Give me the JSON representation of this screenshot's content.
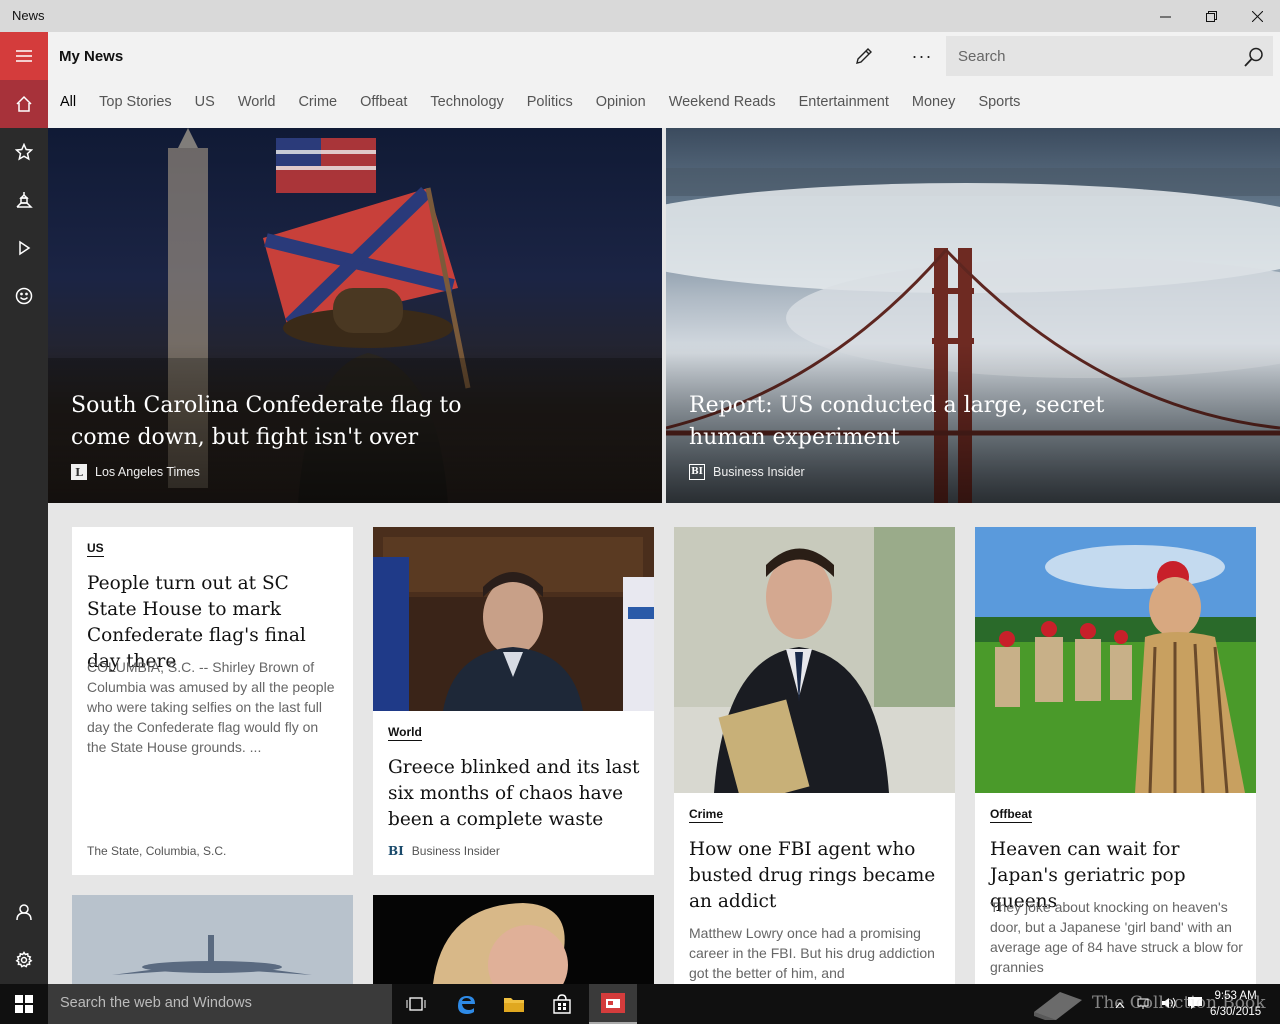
{
  "window": {
    "title": "News"
  },
  "header": {
    "page_title": "My News",
    "search_placeholder": "Search",
    "more_label": "···"
  },
  "tabs": [
    "All",
    "Top Stories",
    "US",
    "World",
    "Crime",
    "Offbeat",
    "Technology",
    "Politics",
    "Opinion",
    "Weekend Reads",
    "Entertainment",
    "Money",
    "Sports"
  ],
  "hero": [
    {
      "title": "South Carolina Confederate flag to come down, but fight isn't over",
      "source": "Los Angeles Times",
      "logo": "L"
    },
    {
      "title": "Report: US conducted a large, secret human experiment",
      "source": "Business Insider",
      "logo": "BI"
    }
  ],
  "cards": [
    {
      "category": "US",
      "title": "People turn out at SC State House to mark Confederate flag's final day there",
      "description": "COLUMBIA, S.C. -- Shirley Brown of Columbia was amused by all the people who were taking selfies on the last full day the Confederate flag would fly on the State House grounds. ...",
      "source": "The State, Columbia, S.C."
    },
    {
      "category": "World",
      "title": "Greece blinked and its last six months of chaos have been a complete waste",
      "source": "Business Insider",
      "logo": "BI"
    },
    {
      "category": "Crime",
      "title": "How one FBI agent who busted drug rings became an addict",
      "description": "Matthew Lowry once had a promising career in the FBI. But his drug addiction got the better of him, and"
    },
    {
      "category": "Offbeat",
      "title": "Heaven can wait for Japan's geriatric pop queens",
      "description": "They joke about knocking on heaven's door, but a Japanese 'girl band' with an average age of 84 have struck a blow for grannies"
    }
  ],
  "taskbar": {
    "search_placeholder": "Search the web and Windows",
    "time": "9:53 AM",
    "date": "6/30/2015"
  },
  "watermark": "The Collection Book",
  "colors": {
    "accent": "#d43c3c",
    "rail": "#2b2b2b",
    "home_active": "#a7323a"
  }
}
